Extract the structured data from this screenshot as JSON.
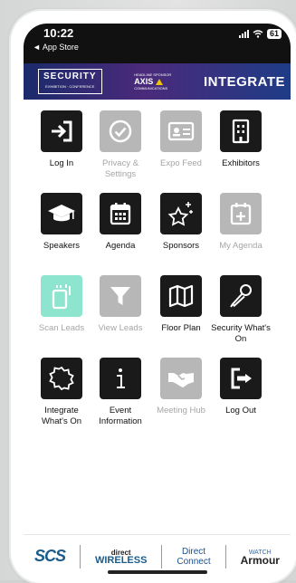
{
  "status_bar": {
    "time": "10:22",
    "back_app": "◄ App Store",
    "battery": "61"
  },
  "banner": {
    "left_logo": "SECURITY",
    "left_logo_sub": "EXHIBITION · CONFERENCE",
    "sponsor_caption": "HEADLINE SPONSOR",
    "sponsor_name": "AXIS",
    "sponsor_sub": "COMMUNICATIONS",
    "right_text": "INTEGRATE"
  },
  "tiles": [
    {
      "label": "Log In",
      "icon": "login-icon",
      "style": "dark",
      "enabled": true
    },
    {
      "label": "Privacy & Settings",
      "icon": "check-circle-icon",
      "style": "gray",
      "enabled": false
    },
    {
      "label": "Expo Feed",
      "icon": "id-card-icon",
      "style": "gray",
      "enabled": false
    },
    {
      "label": "Exhibitors",
      "icon": "building-icon",
      "style": "dark",
      "enabled": true
    },
    {
      "label": "Speakers",
      "icon": "graduation-cap-icon",
      "style": "dark",
      "enabled": true
    },
    {
      "label": "Agenda",
      "icon": "calendar-icon",
      "style": "dark",
      "enabled": true
    },
    {
      "label": "Sponsors",
      "icon": "stars-icon",
      "style": "dark",
      "enabled": true
    },
    {
      "label": "My Agenda",
      "icon": "calendar-plus-icon",
      "style": "gray",
      "enabled": false
    },
    {
      "label": "Scan Leads",
      "icon": "scan-icon",
      "style": "mint",
      "enabled": false
    },
    {
      "label": "View Leads",
      "icon": "filter-icon",
      "style": "gray",
      "enabled": false
    },
    {
      "label": "Floor Plan",
      "icon": "map-icon",
      "style": "dark",
      "enabled": true
    },
    {
      "label": "Security What's On",
      "icon": "microphone-icon",
      "style": "dark",
      "enabled": true
    },
    {
      "label": "Integrate What's On",
      "icon": "badge-icon",
      "style": "dark",
      "enabled": true
    },
    {
      "label": "Event Information",
      "icon": "info-icon",
      "style": "dark",
      "enabled": true
    },
    {
      "label": "Meeting Hub",
      "icon": "handshake-icon",
      "style": "gray",
      "enabled": false
    },
    {
      "label": "Log Out",
      "icon": "logout-icon",
      "style": "dark",
      "enabled": true
    }
  ],
  "footer": {
    "scs": "SCS",
    "direct_wireless_top": "direct",
    "direct_wireless_bottom": "WIRELESS",
    "direct_connect_top": "Direct",
    "direct_connect_bottom": "Connect",
    "watch_top": "WATCH",
    "watch_bottom": "Armour"
  }
}
